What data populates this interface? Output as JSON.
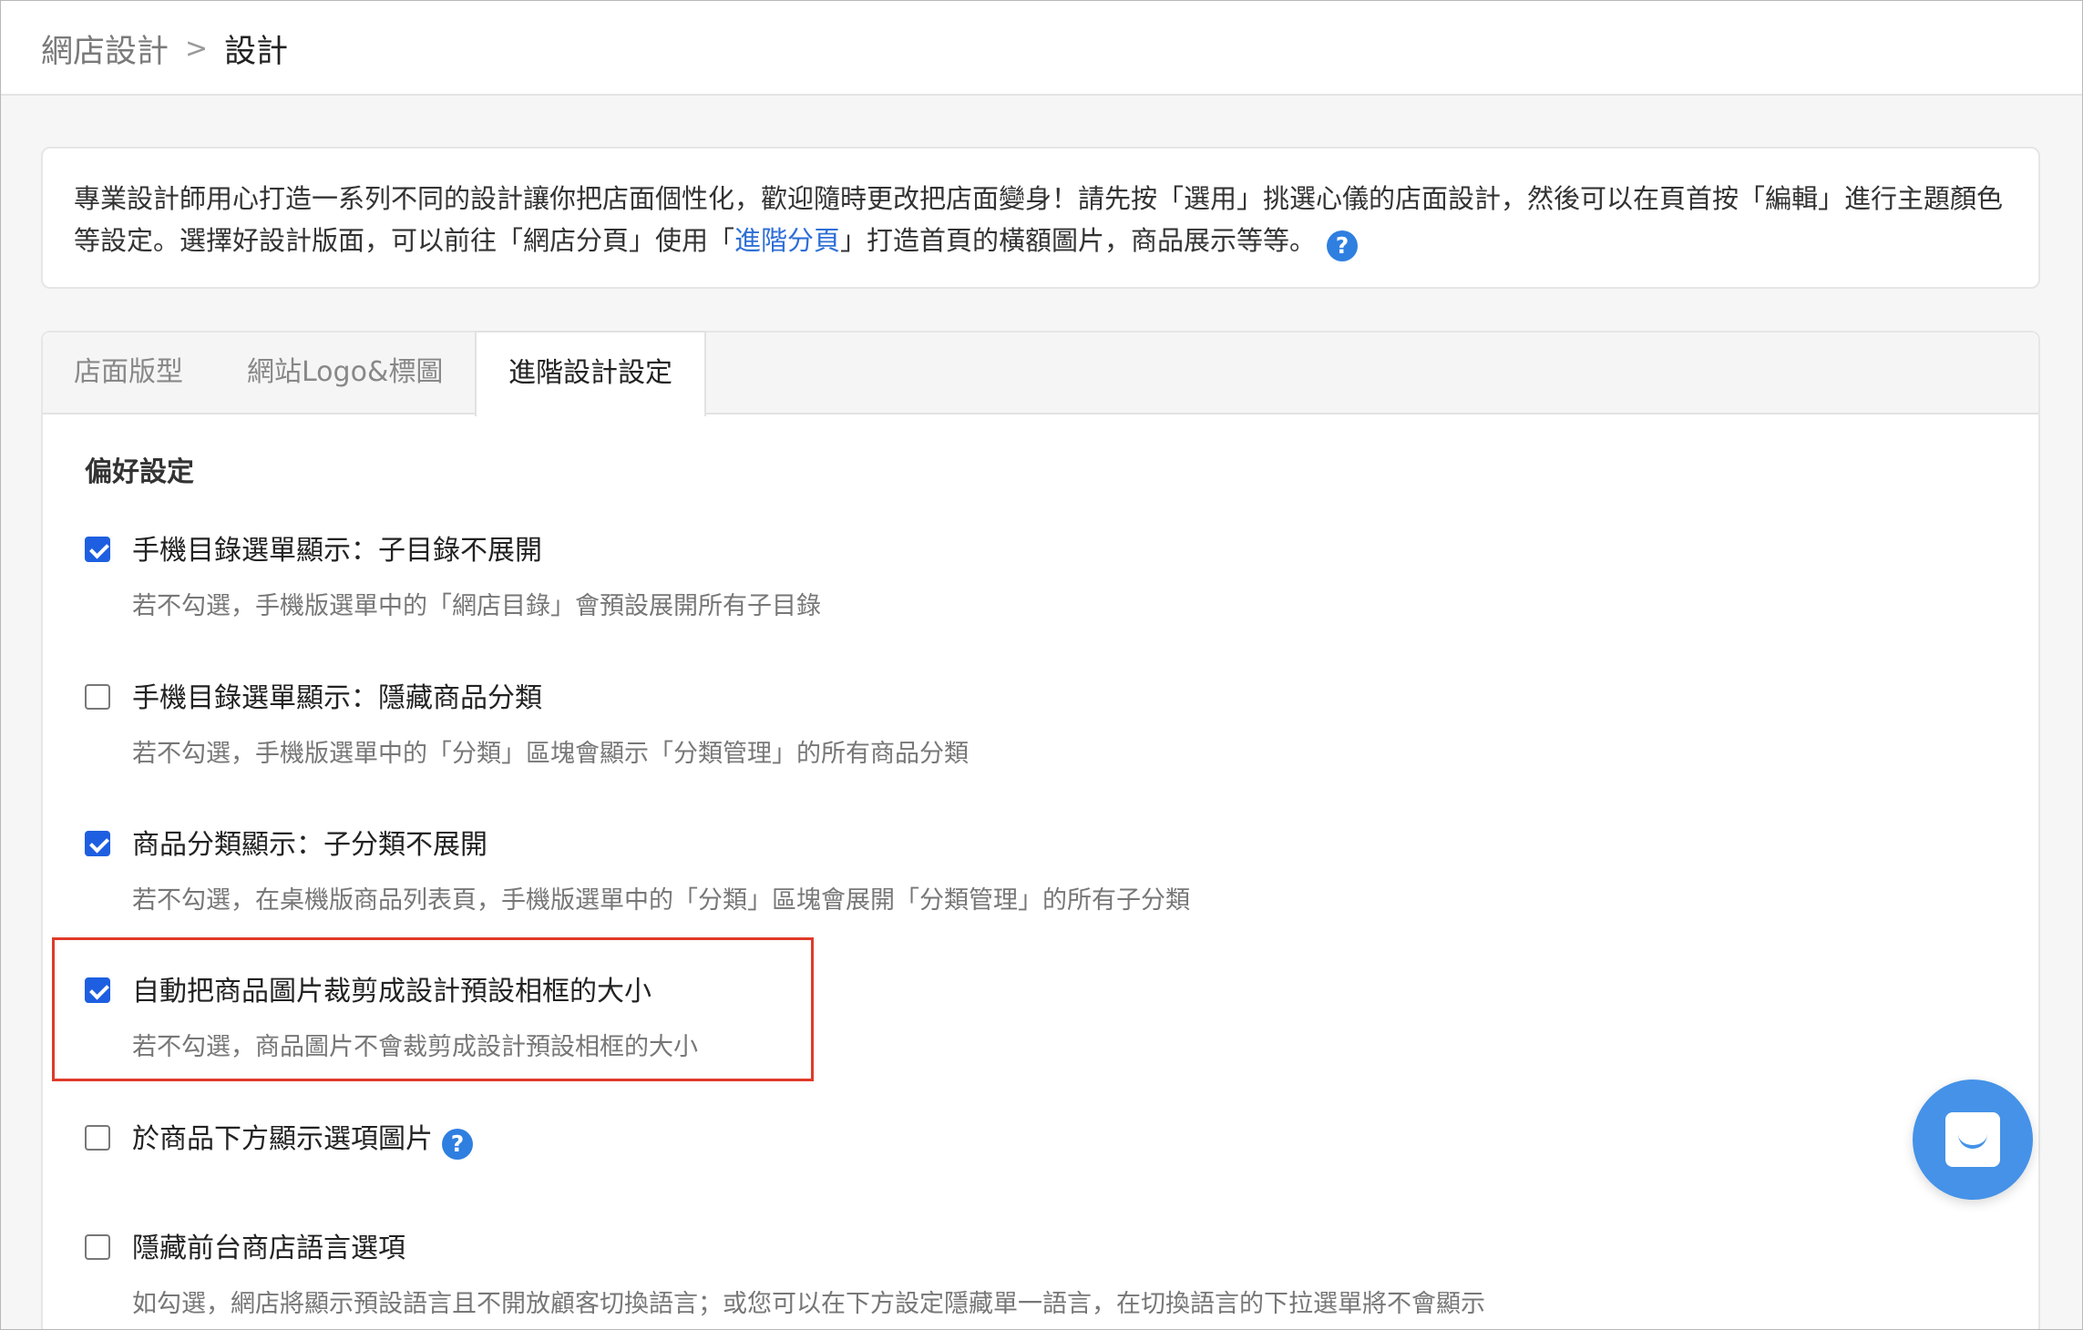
{
  "breadcrumb": {
    "parent": "網店設計",
    "separator": ">",
    "current": "設計"
  },
  "intro": {
    "text_before": "專業設計師用心打造一系列不同的設計讓你把店面個性化，歡迎隨時更改把店面變身！請先按「選用」挑選心儀的店面設計，然後可以在頁首按「編輯」進行主題顏色等設定。選擇好設計版面，可以前往「網店分頁」使用「",
    "link": "進階分頁",
    "text_after": "」打造首頁的橫額圖片，商品展示等等。",
    "help_icon": "?"
  },
  "tabs": [
    {
      "label": "店面版型",
      "active": false
    },
    {
      "label": "網站Logo&標圖",
      "active": false
    },
    {
      "label": "進階設計設定",
      "active": true
    }
  ],
  "section": {
    "title": "偏好設定"
  },
  "options": [
    {
      "label": "手機目錄選單顯示：子目錄不展開",
      "description": "若不勾選，手機版選單中的「網店目錄」會預設展開所有子目錄",
      "checked": true
    },
    {
      "label": "手機目錄選單顯示：隱藏商品分類",
      "description": "若不勾選，手機版選單中的「分類」區塊會顯示「分類管理」的所有商品分類",
      "checked": false
    },
    {
      "label": "商品分類顯示：子分類不展開",
      "description": "若不勾選，在桌機版商品列表頁，手機版選單中的「分類」區塊會展開「分類管理」的所有子分類",
      "checked": true
    },
    {
      "label": "自動把商品圖片裁剪成設計預設相框的大小",
      "description": "若不勾選，商品圖片不會裁剪成設計預設相框的大小",
      "checked": true,
      "highlighted": true
    },
    {
      "label": "於商品下方顯示選項圖片",
      "description": "",
      "checked": false,
      "help_icon": "?"
    },
    {
      "label": "隱藏前台商店語言選項",
      "description": "如勾選，網店將顯示預設語言且不開放顧客切換語言；或您可以在下方設定隱藏單一語言，在切換語言的下拉選單將不會顯示",
      "checked": false
    }
  ],
  "chat": {
    "icon": "chat-icon"
  },
  "colors": {
    "accent": "#1d5fe0",
    "link": "#2f6fd6",
    "highlight": "#e03a2a",
    "chat": "#4592e8"
  }
}
